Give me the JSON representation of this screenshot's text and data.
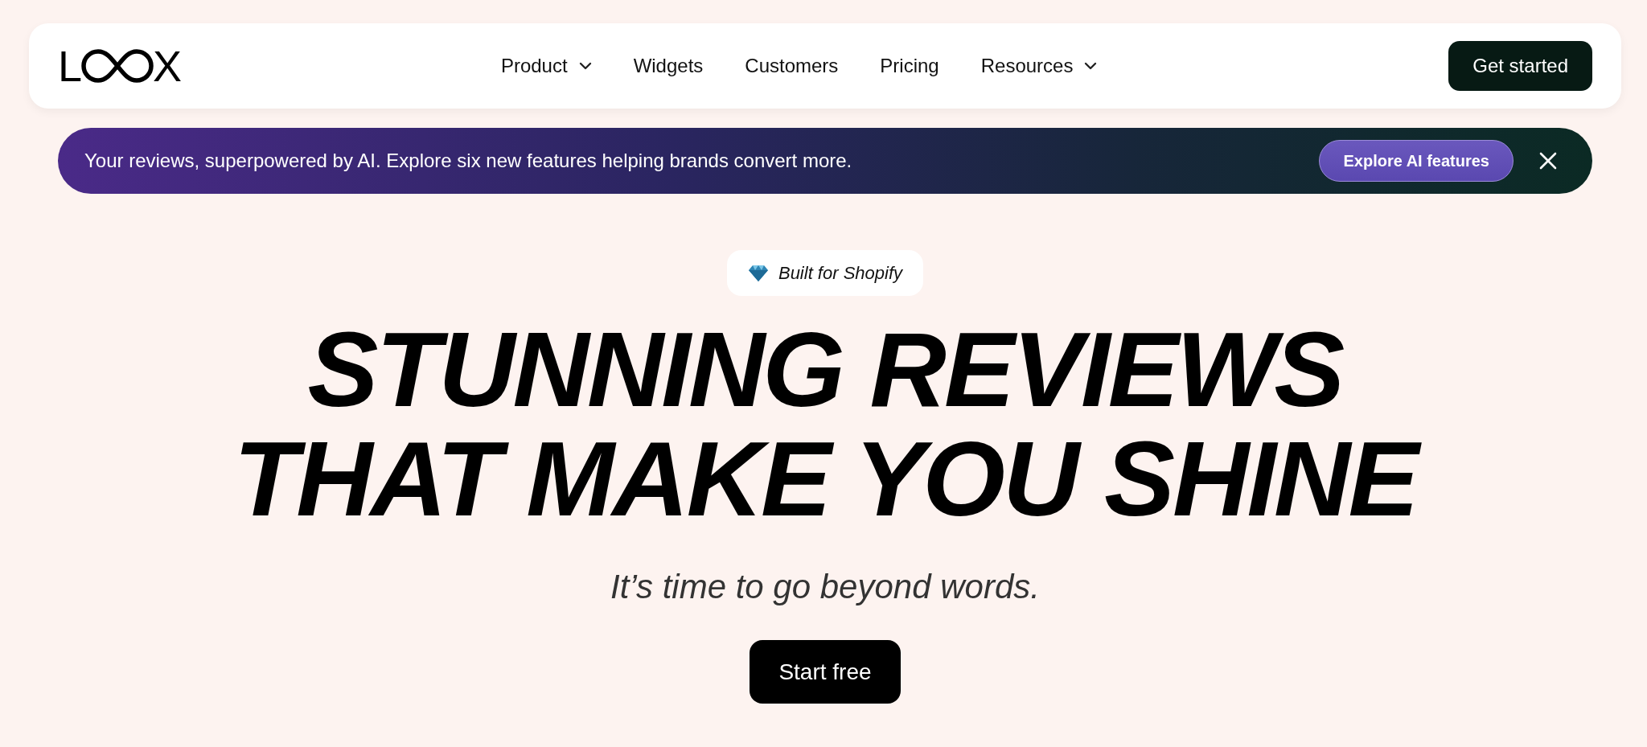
{
  "logo": {
    "left": "L",
    "right": "X"
  },
  "nav": [
    {
      "label": "Product",
      "dropdown": true
    },
    {
      "label": "Widgets",
      "dropdown": false
    },
    {
      "label": "Customers",
      "dropdown": false
    },
    {
      "label": "Pricing",
      "dropdown": false
    },
    {
      "label": "Resources",
      "dropdown": true
    }
  ],
  "cta": "Get started",
  "banner": {
    "text": "Your reviews, superpowered by AI. Explore six new features helping brands convert more.",
    "button": "Explore AI features"
  },
  "badge": "Built for Shopify",
  "headline": [
    "STUNNING REVIEWS",
    "THAT MAKE YOU SHINE"
  ],
  "subtitle": "It’s time to go beyond words.",
  "primary_button": "Start free"
}
